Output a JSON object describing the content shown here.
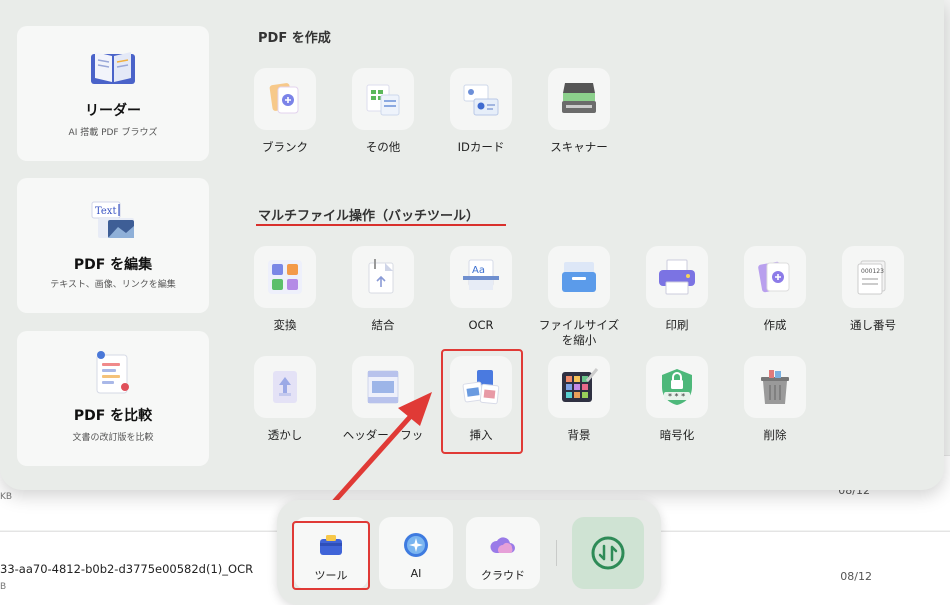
{
  "background_files": {
    "row1_size_fragment": "KB",
    "row1_date": "08/12",
    "row2_name": "33-aa70-4812-b0b2-d3775e00582d(1)_OCR",
    "row2_size_fragment": "B",
    "row2_date": "08/12"
  },
  "cards": [
    {
      "title": "リーダー",
      "subtitle": "AI 搭載 PDF ブラウズ",
      "icon": "book-icon"
    },
    {
      "title": "PDF を編集",
      "subtitle": "テキスト、画像、リンクを編集",
      "icon": "text-image-edit-icon"
    },
    {
      "title": "PDF を比較",
      "subtitle": "文書の改訂版を比較",
      "icon": "compare-document-icon"
    }
  ],
  "create_section": {
    "title": "PDF を作成",
    "tools": [
      {
        "label": "ブランク",
        "icon": "blank-document-icon"
      },
      {
        "label": "その他",
        "icon": "other-formats-icon"
      },
      {
        "label": "IDカード",
        "icon": "id-card-icon"
      },
      {
        "label": "スキャナー",
        "icon": "scanner-icon"
      }
    ]
  },
  "batch_section": {
    "title": "マルチファイル操作（バッチツール）",
    "row1": [
      {
        "label": "変換",
        "icon": "convert-icon"
      },
      {
        "label": "結合",
        "icon": "combine-icon"
      },
      {
        "label": "OCR",
        "icon": "ocr-icon"
      },
      {
        "label": "ファイルサイズ\nを縮小",
        "icon": "compress-icon"
      },
      {
        "label": "印刷",
        "icon": "printer-icon"
      },
      {
        "label": "作成",
        "icon": "create-icon"
      },
      {
        "label": "通し番号",
        "icon": "bates-number-icon"
      }
    ],
    "row2": [
      {
        "label": "透かし",
        "icon": "watermark-icon"
      },
      {
        "label": "ヘッダー・フッ\nタ",
        "icon": "header-footer-icon"
      },
      {
        "label": "挿入",
        "icon": "insert-icon"
      },
      {
        "label": "背景",
        "icon": "background-icon"
      },
      {
        "label": "暗号化",
        "icon": "encrypt-icon"
      },
      {
        "label": "削除",
        "icon": "delete-icon"
      }
    ]
  },
  "dock": {
    "tools_label": "ツール",
    "ai_label": "AI",
    "cloud_label": "クラウド"
  },
  "colors": {
    "highlight": "#e03a36",
    "panel": "#e9ece9",
    "toggle": "#cfe3d3",
    "toggle_icon": "#2e8b57"
  }
}
